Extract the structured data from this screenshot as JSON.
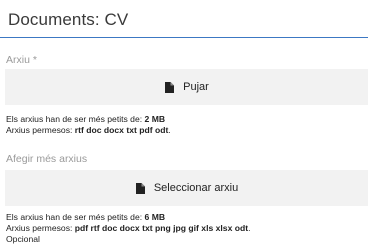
{
  "header": {
    "title": "Documents: CV"
  },
  "upload_cv": {
    "label": "Arxiu *",
    "button_label": "Pujar",
    "size_text": "Els arxius han de ser més petits de: ",
    "size_value": "2 MB",
    "types_text": "Arxius permesos: ",
    "types_value": "rtf doc docx txt pdf odt",
    "types_suffix": "."
  },
  "upload_more": {
    "label": "Afegir més arxius",
    "button_label": "Seleccionar arxiu",
    "size_text": "Els arxius han de ser més petits de: ",
    "size_value": "6 MB",
    "types_text": "Arxius permesos: ",
    "types_value": "pdf rtf doc docx txt png jpg gif xls xlsx odt",
    "types_suffix": ".",
    "optional_text": "Opcional"
  },
  "icons": {
    "upload": "file-icon"
  }
}
